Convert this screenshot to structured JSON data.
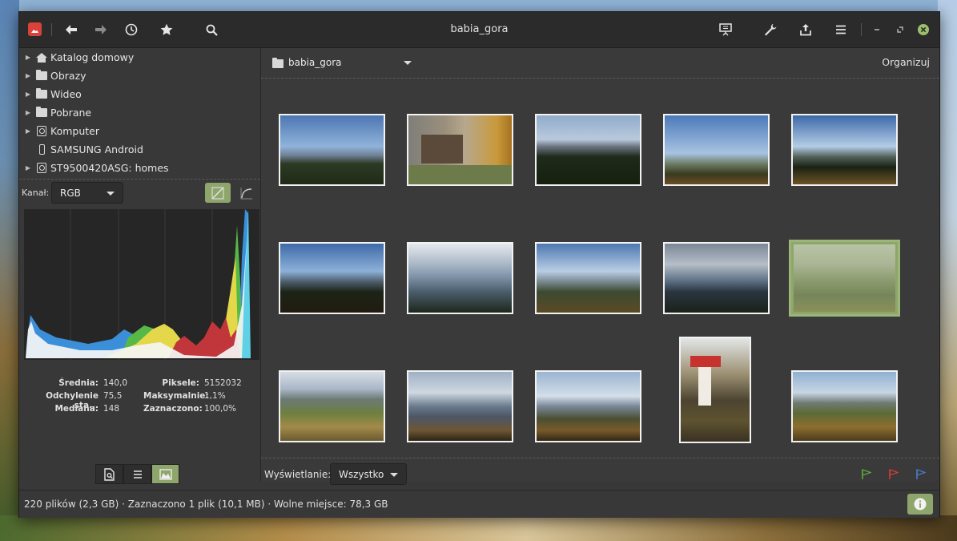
{
  "window": {
    "title": "babia_gora"
  },
  "toolbar": {
    "icons": [
      "app-icon",
      "back-icon",
      "forward-icon",
      "history-icon",
      "bookmarks-icon",
      "search-icon",
      "slideshow-icon",
      "tools-icon",
      "export-icon",
      "menu-icon",
      "minimize-icon",
      "maximize-icon",
      "close-icon"
    ]
  },
  "sidebar": {
    "places": [
      {
        "label": "Katalog domowy",
        "icon": "home-icon",
        "expandable": true
      },
      {
        "label": "Obrazy",
        "icon": "folder-icon",
        "expandable": true
      },
      {
        "label": "Wideo",
        "icon": "folder-icon",
        "expandable": true
      },
      {
        "label": "Pobrane",
        "icon": "folder-icon",
        "expandable": true
      },
      {
        "label": "Komputer",
        "icon": "disk-icon",
        "expandable": true
      },
      {
        "label": "SAMSUNG Android",
        "icon": "phone-icon",
        "expandable": false
      },
      {
        "label": "ST9500420ASG: homes",
        "icon": "disk-icon",
        "expandable": true
      }
    ],
    "histogram": {
      "channel_label": "Kanał:",
      "channel_value": "RGB",
      "stats": {
        "mean_label": "Średnia:",
        "mean_value": "140,0",
        "stddev_label": "Odchylenie sta...",
        "stddev_value": "75,5",
        "median_label": "Mediana:",
        "median_value": "148",
        "pixels_label": "Piksele:",
        "pixels_value": "5152032",
        "max_label": "Maksymalnie:",
        "max_value": "1,1%",
        "selected_label": "Zaznaczono:",
        "selected_value": "100,0%"
      }
    }
  },
  "main": {
    "folder_name": "babia_gora",
    "organize_label": "Organizuj",
    "filter_label": "Wyświetlanie:",
    "filter_value": "Wszystko",
    "flag_colors": [
      "#5fa83a",
      "#d23b3b",
      "#4b79c8"
    ]
  },
  "status": {
    "summary": "220 plików (2,3 GB)  ·  Zaznaczono 1 plik (10,1 MB)  ·  Wolne miejsce: 78,3 GB"
  },
  "colors": {
    "accent": "#8ea66b",
    "background": "#383838",
    "titlebar": "#2b2b2b"
  }
}
